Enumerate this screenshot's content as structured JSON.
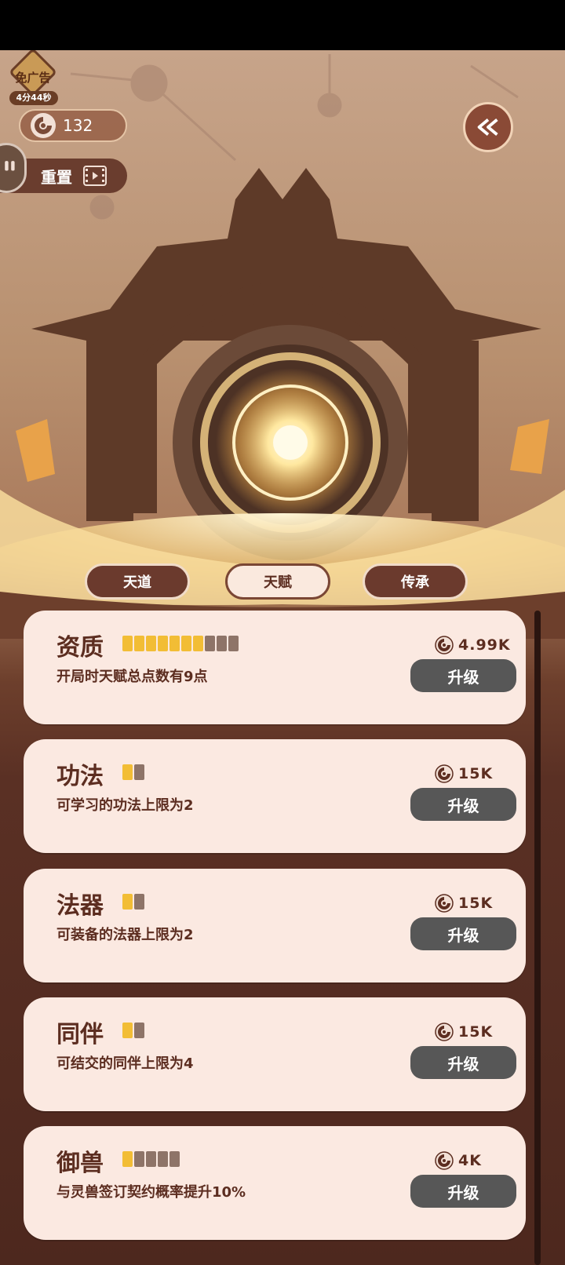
{
  "ad_badge": {
    "label": "免广告",
    "timer": "4分44秒"
  },
  "currency": {
    "icon": "spirit-coin-icon",
    "amount": "132"
  },
  "reset_button": {
    "label": "重置",
    "icon": "video-ad-icon"
  },
  "back_button": {
    "icon": "double-chevron-left-icon"
  },
  "tabs": [
    {
      "label": "天道",
      "active": false
    },
    {
      "label": "天赋",
      "active": true
    },
    {
      "label": "传承",
      "active": false
    }
  ],
  "talents": [
    {
      "title": "资质",
      "level": 7,
      "max": 10,
      "desc": "开局时天赋总点数有9点",
      "cost": "4.99K",
      "button": "升级"
    },
    {
      "title": "功法",
      "level": 1,
      "max": 2,
      "desc": "可学习的功法上限为2",
      "cost": "15K",
      "button": "升级"
    },
    {
      "title": "法器",
      "level": 1,
      "max": 2,
      "desc": "可装备的法器上限为2",
      "cost": "15K",
      "button": "升级"
    },
    {
      "title": "同伴",
      "level": 1,
      "max": 2,
      "desc": "可结交的同伴上限为4",
      "cost": "15K",
      "button": "升级"
    },
    {
      "title": "御兽",
      "level": 1,
      "max": 5,
      "desc": "与灵兽签订契约概率提升10%",
      "cost": "4K",
      "button": "升级"
    }
  ],
  "colors": {
    "accent": "#f2bd35",
    "card": "#fbe9e1",
    "button": "#575757",
    "text": "#5c2d20"
  }
}
